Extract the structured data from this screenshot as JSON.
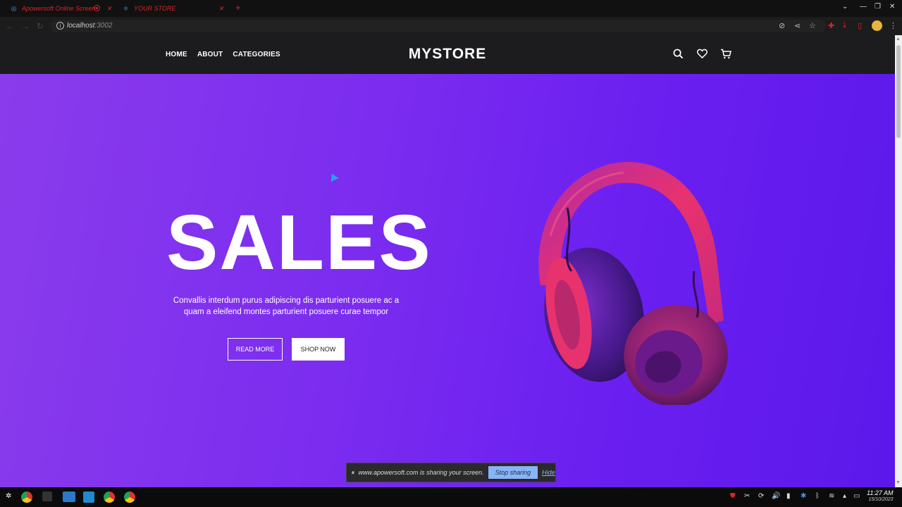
{
  "browser": {
    "tabs": [
      {
        "label": "Apowersoft Online Screen",
        "active": false
      },
      {
        "label": "YOUR STORE",
        "active": true
      }
    ],
    "url_host": "localhost",
    "url_port": ":3002"
  },
  "site": {
    "logo": "MYSTORE",
    "menu": [
      "HOME",
      "ABOUT",
      "CATEGORIES"
    ],
    "icons": [
      "search-icon",
      "heart-icon",
      "cart-icon"
    ]
  },
  "hero": {
    "title": "SALES",
    "text": "Convallis interdum purus adipiscing dis parturient posuere ac a quam a eleifend montes parturient posuere curae tempor",
    "read_more": "READ MORE",
    "shop_now": "SHOP NOW",
    "image": "headphones-image"
  },
  "share_bar": {
    "message": "www.apowersoft.com is sharing your screen.",
    "stop": "Stop sharing",
    "hide": "Hide"
  },
  "taskbar": {
    "time": "11:27 AM",
    "date": "15/10/2023"
  },
  "colors": {
    "hero_start": "#8a3cec",
    "hero_end": "#5b18ea",
    "nav_bg": "#1c1b1d",
    "headphone_pink": "#e8326e"
  }
}
